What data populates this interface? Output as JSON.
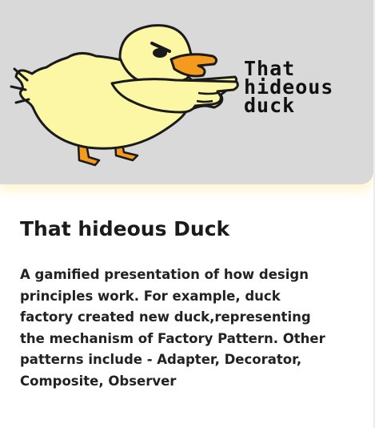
{
  "hero": {
    "image_title": "That\nhideous\nduck",
    "colors": {
      "background": "#d9d9d9",
      "duck_body": "#fbf7a4",
      "beak_feet": "#f39a1f",
      "outline": "#1a1a1a"
    },
    "icon": "duck-illustration"
  },
  "card": {
    "title": "That hideous Duck",
    "description": "A gamified presentation of how design principles work. For example, duck factory created new duck,representing the mechanism of Factory Pattern. Other patterns include - Adapter, Decorator, Composite, Observer"
  }
}
